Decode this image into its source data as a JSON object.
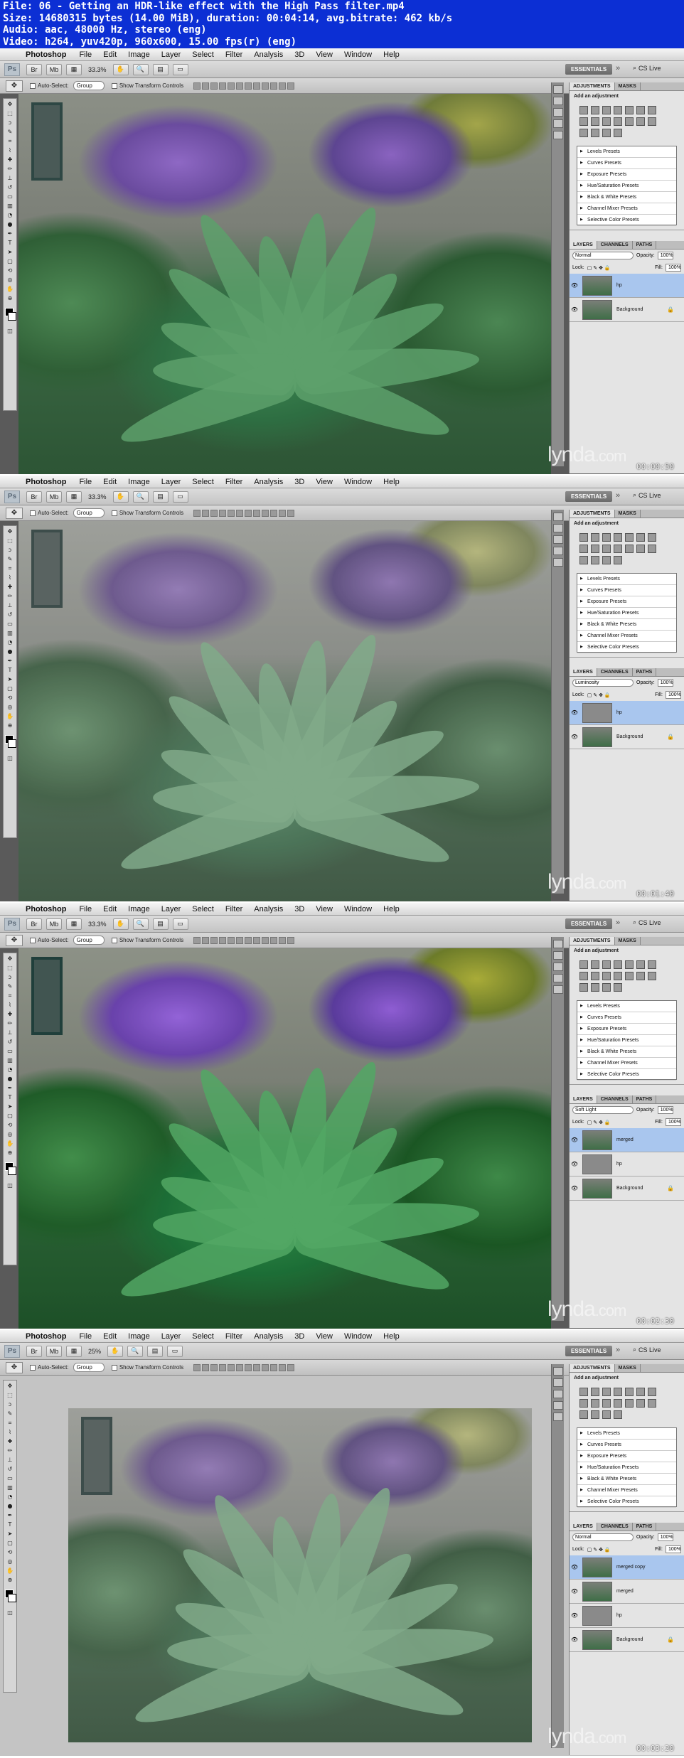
{
  "header": {
    "line1": "File: 06 - Getting an HDR-like effect with the High Pass filter.mp4",
    "line2": "Size: 14680315 bytes (14.00 MiB), duration: 00:04:14, avg.bitrate: 462 kb/s",
    "line3": "Audio: aac, 48000 Hz, stereo (eng)",
    "line4": "Video: h264, yuv420p, 960x600, 15.00 fps(r) (eng)"
  },
  "menu": {
    "app": "Photoshop",
    "items": [
      "File",
      "Edit",
      "Image",
      "Layer",
      "Select",
      "Filter",
      "Analysis",
      "3D",
      "View",
      "Window",
      "Help"
    ]
  },
  "appbar": {
    "ps_icon": "Ps",
    "essentials": "ESSENTIALS",
    "cs_live": "CS Live"
  },
  "options": {
    "auto_select": "Auto-Select:",
    "group": "Group",
    "show_transform": "Show Transform Controls"
  },
  "adjustments": {
    "tab_adjustments": "ADJUSTMENTS",
    "tab_masks": "MASKS",
    "add_adjustment": "Add an adjustment",
    "presets": [
      "Levels Presets",
      "Curves Presets",
      "Exposure Presets",
      "Hue/Saturation Presets",
      "Black & White Presets",
      "Channel Mixer Presets",
      "Selective Color Presets"
    ]
  },
  "layers_panel": {
    "tab_layers": "LAYERS",
    "tab_channels": "CHANNELS",
    "tab_paths": "PATHS",
    "opacity_label": "Opacity:",
    "fill_label": "Fill:",
    "lock_label": "Lock:",
    "opacity_value": "100%",
    "fill_value": "100%"
  },
  "watermark": {
    "brand": "lynda",
    "domain": ".com"
  },
  "frames": [
    {
      "zoom": "33.3%",
      "timecode": "00:00:50",
      "blend": "Normal",
      "layers": [
        {
          "name": "hp",
          "selected": true,
          "gray": false
        },
        {
          "name": "Background",
          "selected": false,
          "gray": false,
          "lock": true
        }
      ]
    },
    {
      "zoom": "33.3%",
      "timecode": "00:01:40",
      "blend": "Luminosity",
      "layers": [
        {
          "name": "hp",
          "selected": true,
          "gray": true
        },
        {
          "name": "Background",
          "selected": false,
          "gray": false,
          "lock": true
        }
      ]
    },
    {
      "zoom": "33.3%",
      "timecode": "00:02:30",
      "blend": "Soft Light",
      "layers": [
        {
          "name": "merged",
          "selected": true,
          "gray": false
        },
        {
          "name": "hp",
          "selected": false,
          "gray": true
        },
        {
          "name": "Background",
          "selected": false,
          "gray": false,
          "lock": true
        }
      ]
    },
    {
      "zoom": "25%",
      "timecode": "00:03:20",
      "blend": "Normal",
      "layers": [
        {
          "name": "merged copy",
          "selected": true,
          "gray": false
        },
        {
          "name": "merged",
          "selected": false,
          "gray": false
        },
        {
          "name": "hp",
          "selected": false,
          "gray": true
        },
        {
          "name": "Background",
          "selected": false,
          "gray": false,
          "lock": true
        }
      ]
    }
  ]
}
